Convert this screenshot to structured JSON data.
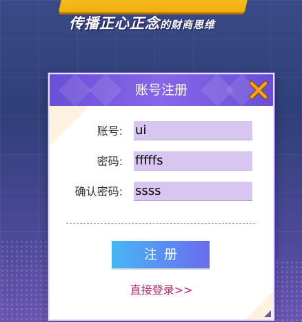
{
  "banner": {
    "subtitle_main": "传播正心正念",
    "subtitle_small": "的财商思维"
  },
  "dialog": {
    "title": "账号注册",
    "close_icon": "close-x-icon",
    "fields": [
      {
        "label": "账号:",
        "value": "ui"
      },
      {
        "label": "密码:",
        "value": "fffffs"
      },
      {
        "label": "确认密码:",
        "value": "ssss"
      }
    ],
    "submit_label": "注册",
    "login_link": "直接登录>>"
  },
  "colors": {
    "header": "#7a5ce0",
    "input_bg": "#d9c6f0",
    "link": "#b3246e",
    "banner_gold": "#ffc21a"
  }
}
